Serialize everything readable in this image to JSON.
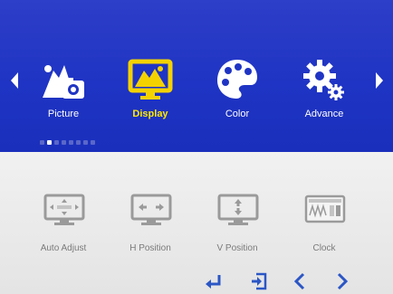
{
  "osd": {
    "main_menu": {
      "items": [
        {
          "label": "Picture",
          "icon": "picture-icon"
        },
        {
          "label": "Display",
          "icon": "display-icon",
          "selected": true
        },
        {
          "label": "Color",
          "icon": "color-palette-icon"
        },
        {
          "label": "Advance",
          "icon": "advance-gear-icon"
        }
      ]
    },
    "page_indicator": {
      "total": 8,
      "active_index": 1
    },
    "submenu": {
      "items": [
        {
          "label": "Auto Adjust",
          "icon": "auto-adjust-icon"
        },
        {
          "label": "H Position",
          "icon": "h-position-icon"
        },
        {
          "label": "V Position",
          "icon": "v-position-icon"
        },
        {
          "label": "Clock",
          "icon": "clock-icon"
        }
      ]
    },
    "nav_buttons": [
      {
        "name": "enter-button",
        "icon": "enter-icon"
      },
      {
        "name": "exit-button",
        "icon": "exit-icon"
      },
      {
        "name": "left-button",
        "icon": "left-icon"
      },
      {
        "name": "right-button",
        "icon": "right-icon"
      }
    ],
    "colors": {
      "top_bg": "#1f34c4",
      "selected_label": "#ffea00",
      "selected_icon": "#f4d200",
      "icon_white": "#ffffff",
      "submenu_icon": "#9a9a9a",
      "submenu_text": "#7a7a7a",
      "nav_blue": "#2b56c5"
    }
  }
}
